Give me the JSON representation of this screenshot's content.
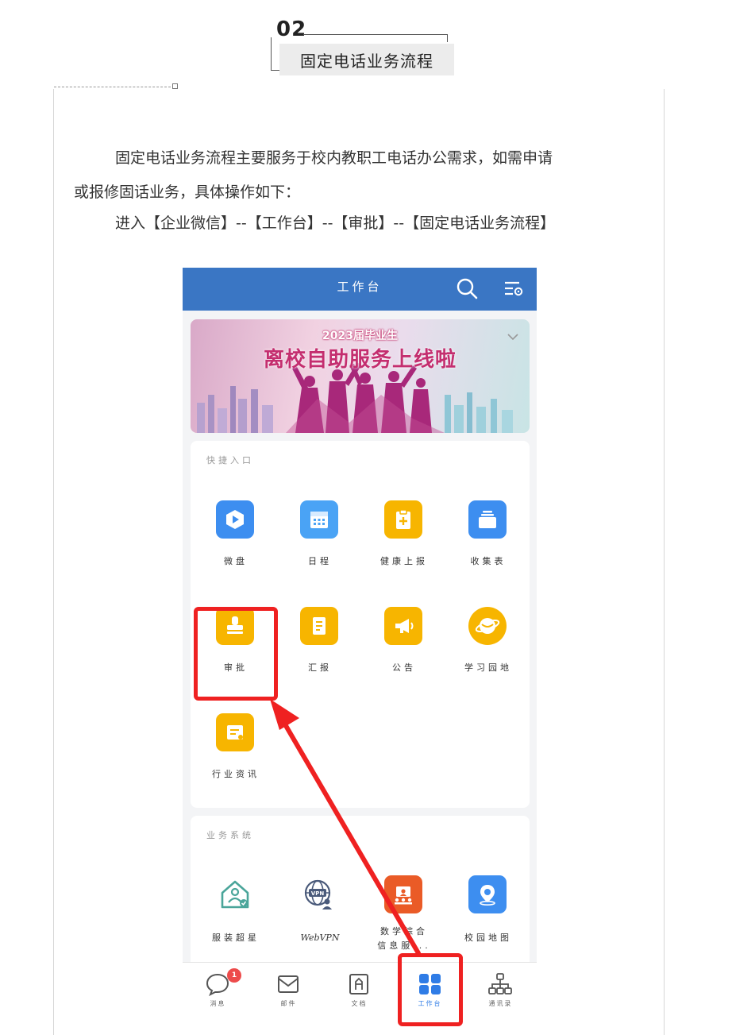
{
  "section": {
    "number": "02",
    "title": "固定电话业务流程"
  },
  "intro": {
    "line1": "固定电话业务流程主要服务于校内教职工电话办公需求，如需申请",
    "line2": "或报修固话业务，具体操作如下：",
    "line3": "进入【企业微信】--【工作台】--【审批】--【固定电话业务流程】"
  },
  "phone": {
    "header_title": "工作台",
    "banner": {
      "subtitle": "2023届毕业生",
      "title": "离校自助服务上线啦"
    },
    "quick_entry": {
      "title": "快捷入口",
      "apps": [
        {
          "label": "微盘",
          "icon": "weipan-icon",
          "color": "#3d8ef0"
        },
        {
          "label": "日程",
          "icon": "calendar-icon",
          "color": "#4aa3f5"
        },
        {
          "label": "健康上报",
          "icon": "health-report-icon",
          "color": "#f7b500"
        },
        {
          "label": "收集表",
          "icon": "collection-form-icon",
          "color": "#3d8ef0"
        },
        {
          "label": "审批",
          "icon": "stamp-icon",
          "color": "#f7b500"
        },
        {
          "label": "汇报",
          "icon": "report-doc-icon",
          "color": "#f7b500"
        },
        {
          "label": "公告",
          "icon": "megaphone-icon",
          "color": "#f7b500"
        },
        {
          "label": "学习园地",
          "icon": "planet-icon",
          "color": "#f7b500"
        },
        {
          "label": "行业资讯",
          "icon": "news-icon",
          "color": "#f7b500"
        }
      ]
    },
    "business": {
      "title": "业务系统",
      "apps": [
        {
          "label": "服装超星",
          "icon": "house-person-icon",
          "color": "#4aa59a"
        },
        {
          "label": "WebVPN",
          "icon": "vpn-globe-icon",
          "color": "#4a5a7a"
        },
        {
          "label": "数学综合信息服...",
          "icon": "teaching-screen-icon",
          "color": "#ea5b27"
        },
        {
          "label": "校园地图",
          "icon": "map-pin-icon",
          "color": "#3d8ef0"
        }
      ]
    },
    "bottom_nav": [
      {
        "label": "消息",
        "icon": "chat-bubble-icon",
        "badge": "1"
      },
      {
        "label": "邮件",
        "icon": "mail-icon"
      },
      {
        "label": "文档",
        "icon": "document-icon"
      },
      {
        "label": "工作台",
        "icon": "grid-icon",
        "active": true
      },
      {
        "label": "通讯录",
        "icon": "org-chart-icon"
      }
    ],
    "colors": {
      "header": "#3a76c4",
      "highlight": "#ef2121",
      "active": "#2f7ce6"
    }
  }
}
